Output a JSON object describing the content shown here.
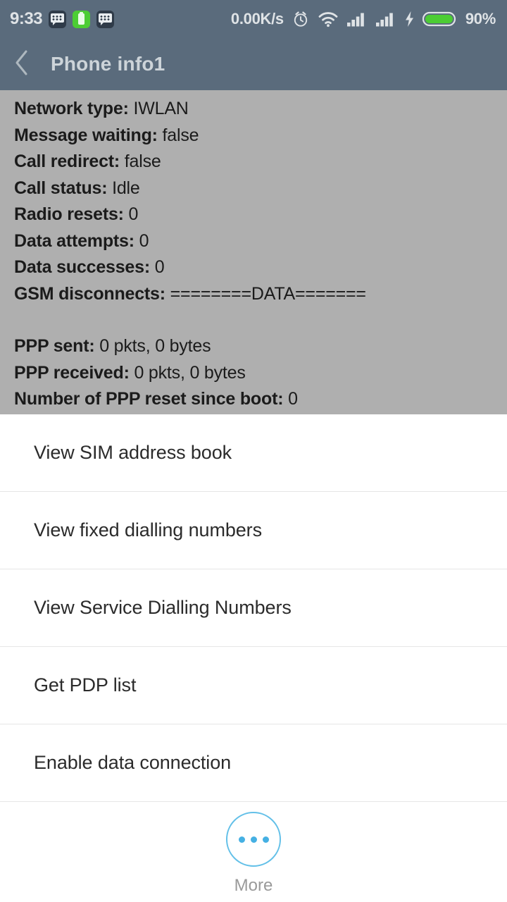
{
  "statusbar": {
    "time": "9:33",
    "network_rate": "0.00K/s",
    "battery_percent": "90%",
    "icons": {
      "app_badge_1": "message-app-icon",
      "app_badge_2": "green-battery-app-icon",
      "app_badge_3": "message-app-icon",
      "alarm": "alarm-clock-icon",
      "wifi": "wifi-icon",
      "signal_1": "signal-bars-icon",
      "signal_2": "signal-bars-icon",
      "charging": "lightning-bolt-icon",
      "battery": "battery-icon"
    },
    "colors": {
      "bar_background": "#5a6b7c",
      "text": "#dfe3e6",
      "battery_fill": "#4ccd34"
    }
  },
  "appbar": {
    "back_icon": "chevron-left-icon",
    "title": "Phone info1",
    "background": "#5a6b7c",
    "title_color": "#cdd4d9"
  },
  "content": {
    "background": "#afafaf",
    "rows": [
      {
        "key": "Network type:",
        "value": "IWLAN"
      },
      {
        "key": "Message waiting:",
        "value": "false"
      },
      {
        "key": "Call redirect:",
        "value": "false"
      },
      {
        "key": "Call status:",
        "value": "Idle"
      },
      {
        "key": "Radio resets:",
        "value": "0"
      },
      {
        "key": "Data attempts:",
        "value": "0"
      },
      {
        "key": "Data successes:",
        "value": "0"
      },
      {
        "key": "GSM disconnects:",
        "value": "========DATA======="
      },
      {
        "key": "",
        "value": ""
      },
      {
        "key": "PPP sent:",
        "value": "0 pkts, 0 bytes"
      },
      {
        "key": "PPP received:",
        "value": "0 pkts, 0 bytes"
      },
      {
        "key": "Number of PPP reset since boot:",
        "value": "0"
      }
    ]
  },
  "sheet": {
    "items": [
      {
        "label": "View SIM address book"
      },
      {
        "label": "View fixed dialling numbers"
      },
      {
        "label": "View Service Dialling Numbers"
      },
      {
        "label": "Get PDP list"
      },
      {
        "label": "Enable data connection"
      }
    ],
    "more": {
      "label": "More",
      "icon": "three-dots-icon",
      "accent_color": "#45b0e3"
    }
  }
}
